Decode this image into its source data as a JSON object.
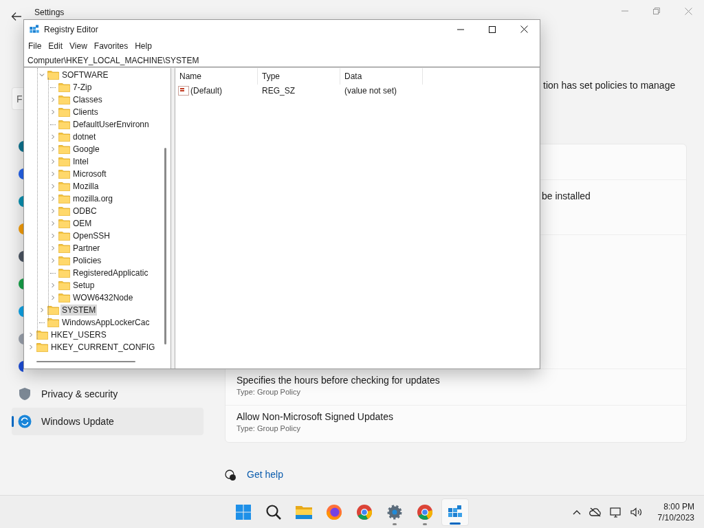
{
  "settings": {
    "title": "Settings",
    "search": {
      "placeholder": "F"
    },
    "sidebar": {
      "items": [
        {
          "kind": "icon"
        },
        {
          "kind": "icon"
        },
        {
          "kind": "icon"
        },
        {
          "kind": "icon"
        },
        {
          "kind": "icon"
        },
        {
          "kind": "icon"
        },
        {
          "kind": "icon"
        },
        {
          "kind": "icon"
        },
        {
          "kind": "icon"
        },
        {
          "kind": "entry",
          "label": "Privacy & security",
          "selected": false
        },
        {
          "kind": "entry",
          "label": "Windows Update",
          "selected": true
        }
      ]
    },
    "notice": "tion has set policies to manage",
    "policies": [
      {
        "title": "be installed"
      },
      {
        "title": "Specifies the hours before checking for updates",
        "type": "Type: Group Policy"
      },
      {
        "title": "Allow Non-Microsoft Signed Updates",
        "type": "Type: Group Policy"
      }
    ],
    "help_link": "Get help"
  },
  "regedit": {
    "title": "Registry Editor",
    "menu": [
      "File",
      "Edit",
      "View",
      "Favorites",
      "Help"
    ],
    "address": "Computer\\HKEY_LOCAL_MACHINE\\SYSTEM",
    "tree": [
      {
        "children": [
          {
            "label": "SOFTWARE",
            "expanded": true,
            "selected": false,
            "children": [
              {
                "label": "7-Zip",
                "selected": false
              },
              {
                "label": "Classes",
                "expanded": false,
                "selected": false
              },
              {
                "label": "Clients",
                "expanded": false,
                "selected": false
              },
              {
                "label": "DefaultUserEnvironn",
                "selected": false
              },
              {
                "label": "dotnet",
                "expanded": false,
                "selected": false
              },
              {
                "label": "Google",
                "expanded": false,
                "selected": false
              },
              {
                "label": "Intel",
                "expanded": false,
                "selected": false
              },
              {
                "label": "Microsoft",
                "expanded": false,
                "selected": false
              },
              {
                "label": "Mozilla",
                "expanded": false,
                "selected": false
              },
              {
                "label": "mozilla.org",
                "expanded": false,
                "selected": false
              },
              {
                "label": "ODBC",
                "expanded": false,
                "selected": false
              },
              {
                "label": "OEM",
                "expanded": false,
                "selected": false
              },
              {
                "label": "OpenSSH",
                "expanded": false,
                "selected": false
              },
              {
                "label": "Partner",
                "expanded": false,
                "selected": false
              },
              {
                "label": "Policies",
                "expanded": false,
                "selected": false
              },
              {
                "label": "RegisteredApplicatic",
                "selected": false
              },
              {
                "label": "Setup",
                "expanded": false,
                "selected": false
              },
              {
                "label": "WOW6432Node",
                "expanded": false,
                "selected": false
              }
            ]
          },
          {
            "label": "SYSTEM",
            "expanded": false,
            "selected": true
          },
          {
            "label": "WindowsAppLockerCac",
            "selected": false
          }
        ]
      },
      {
        "label": "HKEY_USERS",
        "expanded": false,
        "selected": false
      },
      {
        "label": "HKEY_CURRENT_CONFIG",
        "expanded": false,
        "selected": false
      }
    ],
    "columns": [
      "Name",
      "Type",
      "Data"
    ],
    "rows": [
      {
        "name": "(Default)",
        "type": "REG_SZ",
        "data": "(value not set)"
      }
    ]
  },
  "taskbar": {
    "apps": [
      {
        "kind": "start",
        "selected": false
      },
      {
        "kind": "search",
        "selected": false
      },
      {
        "kind": "explorer",
        "selected": false
      },
      {
        "kind": "firefox",
        "selected": false
      },
      {
        "kind": "chrome",
        "selected": false
      },
      {
        "kind": "settings",
        "running": true,
        "selected": false
      },
      {
        "kind": "chrome",
        "running": true,
        "selected": false
      },
      {
        "kind": "regedit",
        "running": true,
        "selected": true
      }
    ],
    "time": "8:00 PM",
    "date": "7/10/2023"
  }
}
